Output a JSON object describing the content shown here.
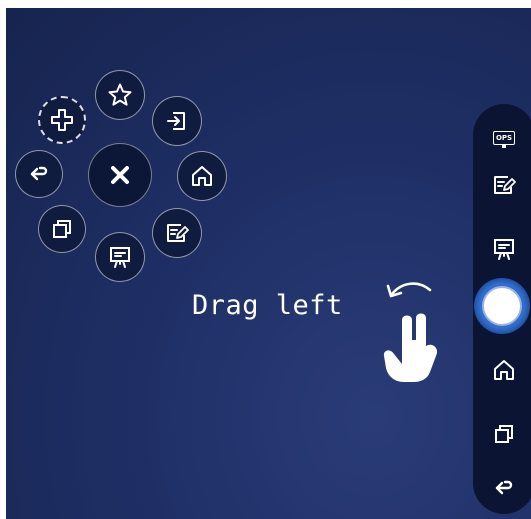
{
  "radial_menu": {
    "items": [
      {
        "name": "add",
        "icon": "plus-icon",
        "style": "dashed"
      },
      {
        "name": "favorites",
        "icon": "star-icon"
      },
      {
        "name": "signal-source",
        "icon": "input-source-icon"
      },
      {
        "name": "home",
        "icon": "home-icon"
      },
      {
        "name": "annotate",
        "icon": "annotate-icon"
      },
      {
        "name": "whiteboard",
        "icon": "whiteboard-icon"
      },
      {
        "name": "multitask",
        "icon": "multitask-icon"
      },
      {
        "name": "back",
        "icon": "back-icon"
      },
      {
        "name": "close",
        "icon": "close-icon"
      }
    ]
  },
  "toolbar": {
    "ops_label": "OPS",
    "items": [
      {
        "name": "ops",
        "icon": "ops-monitor-icon"
      },
      {
        "name": "annotate",
        "icon": "annotate-icon"
      },
      {
        "name": "whiteboard",
        "icon": "whiteboard-icon"
      },
      {
        "name": "floating-ball",
        "icon": "floating-ball-icon"
      },
      {
        "name": "home",
        "icon": "home-icon"
      },
      {
        "name": "multitask",
        "icon": "multitask-icon"
      },
      {
        "name": "back",
        "icon": "back-icon"
      }
    ]
  },
  "hint": {
    "text": "Drag left",
    "gesture_icon": "two-finger-swipe-left-icon"
  },
  "colors": {
    "background": "#1f2f66",
    "toolbar": "#0b1533",
    "button": "#0f1b3f",
    "accent": "#2f6fd6",
    "icon": "#ffffff"
  }
}
